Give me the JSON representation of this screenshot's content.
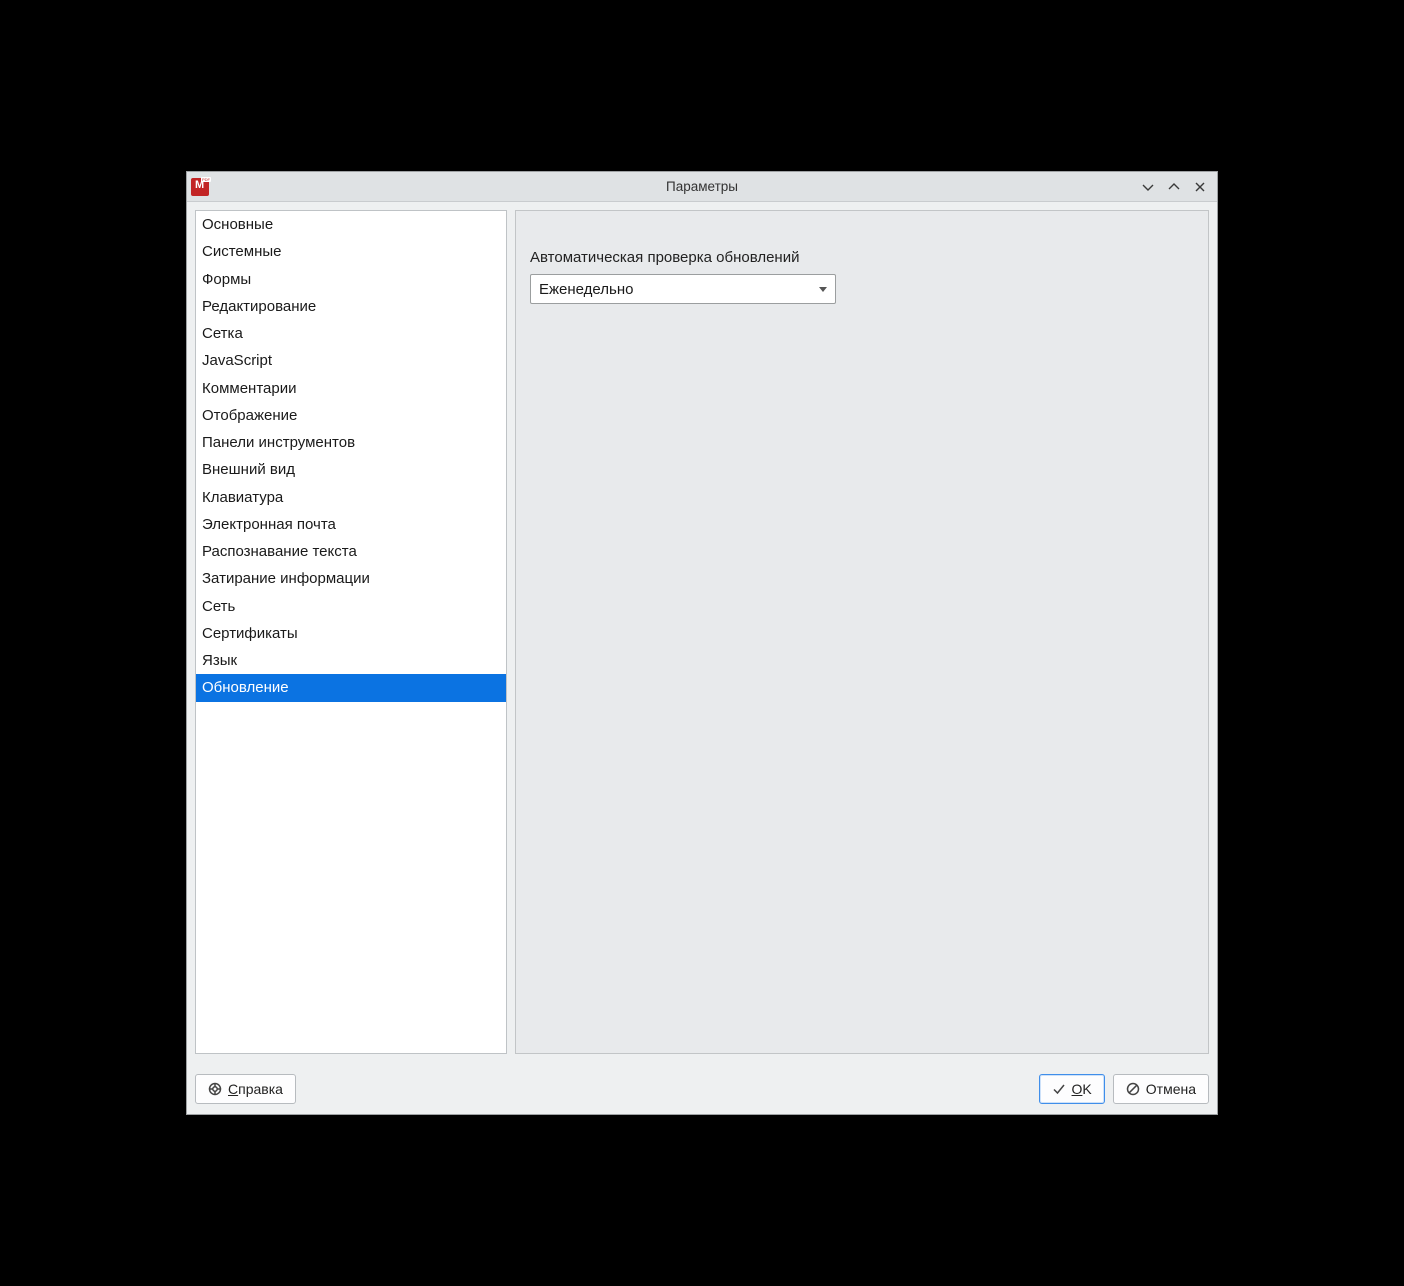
{
  "window": {
    "title": "Параметры"
  },
  "sidebar": {
    "items": [
      {
        "label": "Основные"
      },
      {
        "label": "Системные"
      },
      {
        "label": "Формы"
      },
      {
        "label": "Редактирование"
      },
      {
        "label": "Сетка"
      },
      {
        "label": "JavaScript"
      },
      {
        "label": "Комментарии"
      },
      {
        "label": "Отображение"
      },
      {
        "label": "Панели инструментов"
      },
      {
        "label": "Внешний вид"
      },
      {
        "label": "Клавиатура"
      },
      {
        "label": "Электронная почта"
      },
      {
        "label": "Распознавание текста"
      },
      {
        "label": "Затирание информации"
      },
      {
        "label": "Сеть"
      },
      {
        "label": "Сертификаты"
      },
      {
        "label": "Язык"
      },
      {
        "label": "Обновление"
      }
    ],
    "selected_index": 17
  },
  "content": {
    "update_check_label": "Автоматическая проверка обновлений",
    "update_check_value": "Еженедельно"
  },
  "buttons": {
    "help_prefix": "С",
    "help_rest": "правка",
    "ok_prefix": "O",
    "ok_rest": "K",
    "cancel": "Отмена"
  }
}
